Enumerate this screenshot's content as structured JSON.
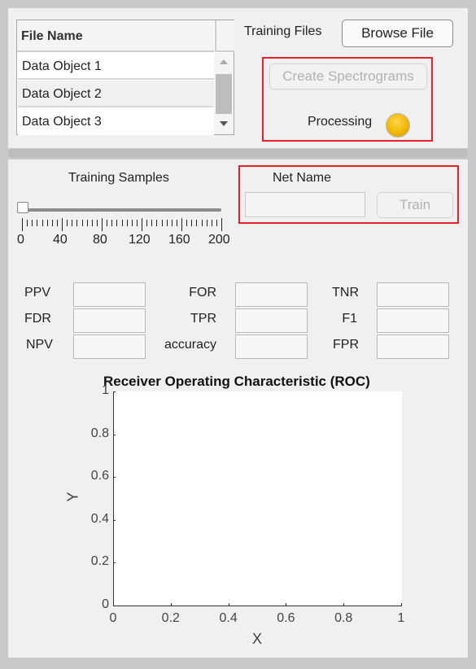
{
  "file_table": {
    "header": "File Name",
    "rows": [
      "Data Object 1",
      "Data Object 2",
      "Data Object 3"
    ]
  },
  "training_files_label": "Training Files",
  "browse_button": "Browse File",
  "create_spectrograms_button": "Create Spectrograms",
  "processing_label": "Processing",
  "lamp_color": "#f0b400",
  "slider": {
    "label": "Training Samples",
    "value": 0,
    "min": 0,
    "max": 200,
    "tick_labels": [
      "0",
      "40",
      "80",
      "120",
      "160",
      "200"
    ]
  },
  "net_name_label": "Net Name",
  "net_name_value": "",
  "train_button": "Train",
  "metrics": {
    "col1": [
      "PPV",
      "FDR",
      "NPV"
    ],
    "col2": [
      "FOR",
      "TPR",
      "accuracy"
    ],
    "col3": [
      "TNR",
      "F1",
      "FPR"
    ]
  },
  "chart_data": {
    "type": "line",
    "title": "Receiver Operating Characteristic (ROC)",
    "xlabel": "X",
    "ylabel": "Y",
    "xlim": [
      0,
      1
    ],
    "ylim": [
      0,
      1
    ],
    "xticks": [
      "0",
      "0.2",
      "0.4",
      "0.6",
      "0.8",
      "1"
    ],
    "yticks": [
      "0",
      "0.2",
      "0.4",
      "0.6",
      "0.8",
      "1"
    ],
    "series": [],
    "grid": false
  }
}
